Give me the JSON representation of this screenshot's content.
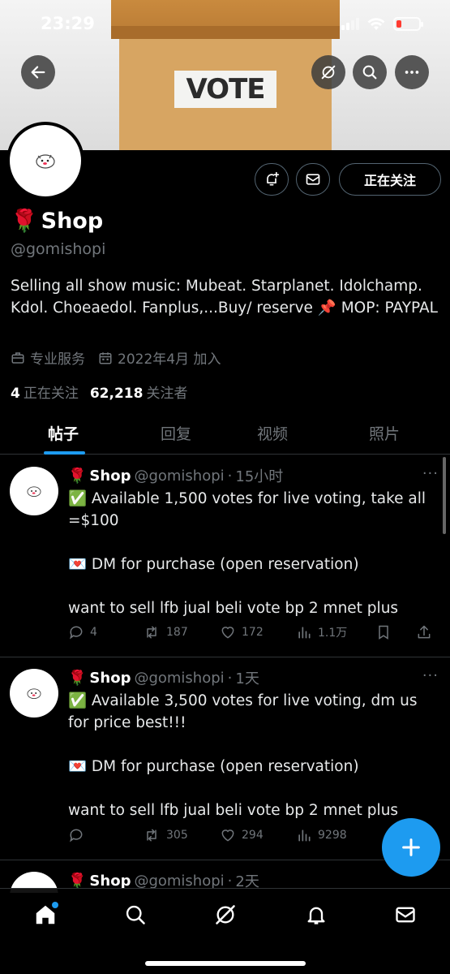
{
  "status_bar": {
    "time": "23:29"
  },
  "banner": {
    "vote_text": "VOTE"
  },
  "profile": {
    "name": "Shop",
    "handle": "@gomishopi",
    "bio": "Selling all show music: Mubeat. Starplanet. Idolchamp. Kdol. Choeaedol. Fanplus,...Buy/ reserve 📌 MOP: PAYPAL",
    "category": "专业服务",
    "joined": "2022年4月 加入",
    "following_count": "4",
    "following_label": "正在关注",
    "followers_count": "62,218",
    "followers_label": "关注者",
    "follow_button": "正在关注"
  },
  "tabs": [
    "帖子",
    "回复",
    "视频",
    "照片"
  ],
  "posts": [
    {
      "name": "Shop",
      "handle": "@gomishopi",
      "time": "15小时",
      "line1": "✅ Available 1,500 votes for live voting, take all =$100",
      "line2": "💌 DM for purchase (open reservation)",
      "line3": "want to sell lfb jual beli vote bp 2 mnet plus",
      "replies": "4",
      "reposts": "187",
      "likes": "172",
      "views": "1.1万"
    },
    {
      "name": "Shop",
      "handle": "@gomishopi",
      "time": "1天",
      "line1": "✅ Available 3,500 votes for live voting, dm us for price best!!!",
      "line2": "💌 DM for purchase (open reservation)",
      "line3": "want to sell lfb jual beli vote bp 2 mnet plus",
      "replies": "",
      "reposts": "305",
      "likes": "294",
      "views": "9298"
    },
    {
      "name": "Shop",
      "handle": "@gomishopi",
      "time": "2天"
    }
  ],
  "colors": {
    "accent": "#1d9bf0",
    "background": "#000000",
    "muted": "#71767b"
  }
}
